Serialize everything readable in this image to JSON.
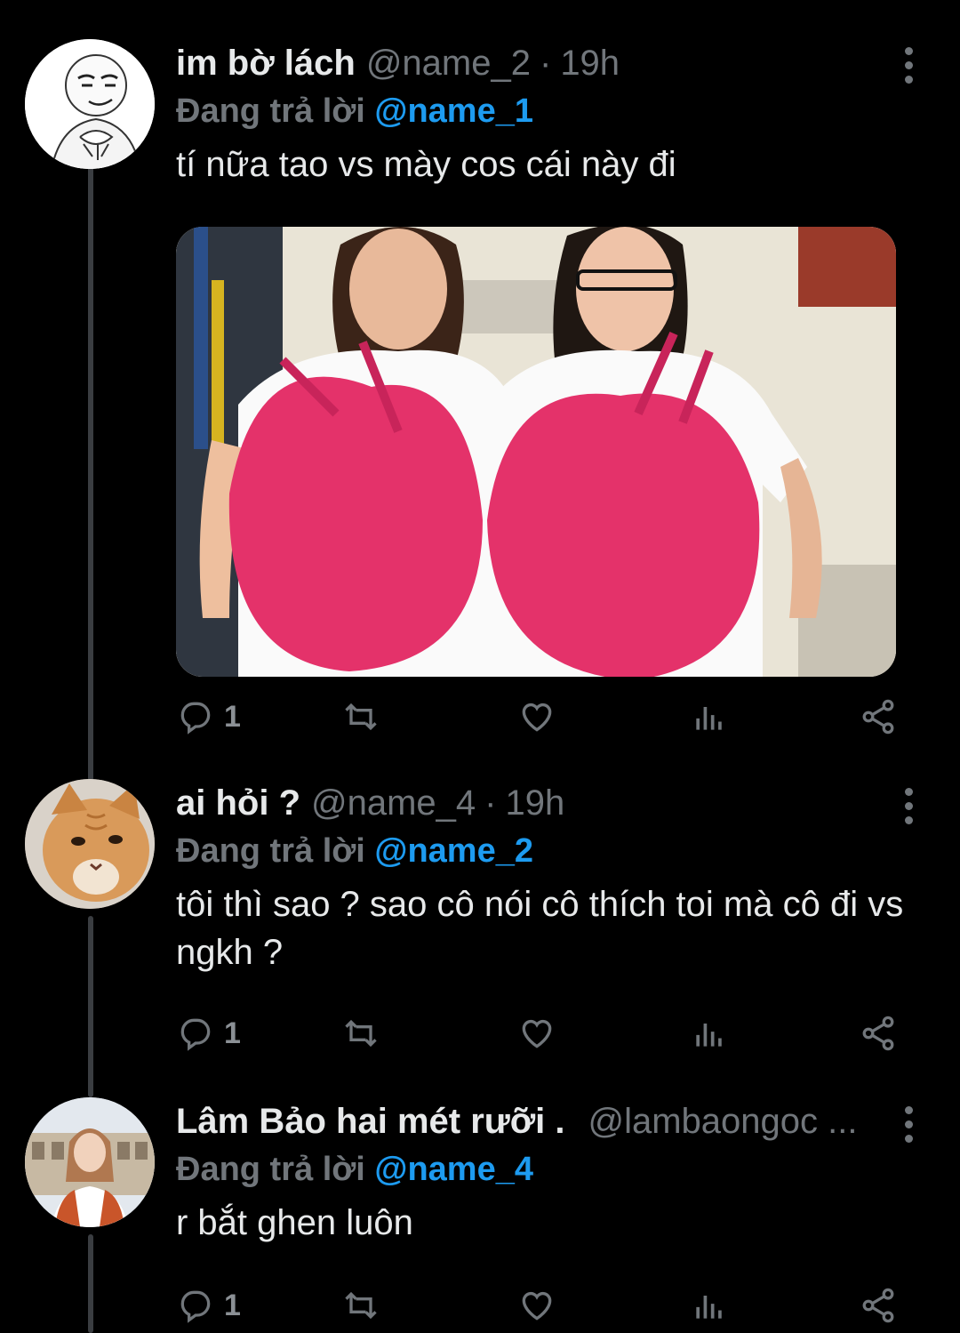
{
  "reply_prefix": "Đang trả lời",
  "tweets": [
    {
      "name": "im bờ lách",
      "handle": "@name_2",
      "separator": "·",
      "time": "19h",
      "reply_to": "@name_1",
      "text": "tí nữa tao vs mày cos cái này đi",
      "reply_count": "1",
      "avatar": "meme-face-icon"
    },
    {
      "name": "ai hỏi ?",
      "handle": "@name_4",
      "separator": "·",
      "time": "19h",
      "reply_to": "@name_2",
      "text": "tôi thì sao ? sao cô nói cô thích toi mà cô đi vs ngkh ?",
      "reply_count": "1",
      "avatar": "cat-face-icon"
    },
    {
      "name": "Lâm Bảo hai mét rưỡi .",
      "handle": "@lambaongoc ...",
      "reply_to": "@name_4",
      "text": "r bắt ghen luôn",
      "reply_count": "1",
      "avatar": "girl-photo-icon"
    }
  ],
  "colors": {
    "background": "#000000",
    "mention": "#1d9bf0",
    "muted": "#71767b",
    "text": "#e7e9ea",
    "thread_line": "#3a3d41"
  }
}
